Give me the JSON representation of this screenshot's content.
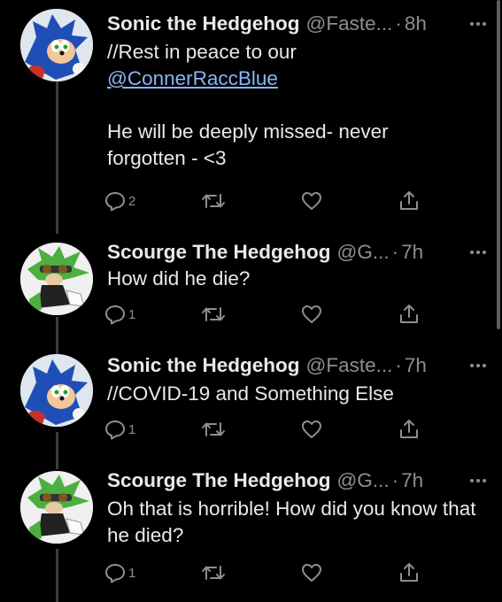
{
  "tweets": [
    {
      "display_name": "Sonic the Hedgehog",
      "handle": "@Faste...",
      "separator": "·",
      "time": "8h",
      "body_prefix": "//Rest in peace to our",
      "mention": "@ConnerRaccBlue",
      "body_suffix": "He will be deeply missed- never forgotten - <3",
      "reply_count": "2",
      "avatar": "sonic-avatar"
    },
    {
      "display_name": "Scourge The Hedgehog",
      "handle": "@G...",
      "separator": "·",
      "time": "7h",
      "body": "How did he die?",
      "reply_count": "1",
      "avatar": "scourge-avatar"
    },
    {
      "display_name": "Sonic the Hedgehog",
      "handle": "@Faste...",
      "separator": "·",
      "time": "7h",
      "body": "//COVID-19 and Something Else",
      "reply_count": "1",
      "avatar": "sonic-avatar"
    },
    {
      "display_name": "Scourge The Hedgehog",
      "handle": "@G...",
      "separator": "·",
      "time": "7h",
      "body": "Oh that is horrible! How did you know that he died?",
      "reply_count": "1",
      "avatar": "scourge-avatar"
    }
  ],
  "icons": {
    "reply": "reply-icon",
    "retweet": "retweet-icon",
    "like": "heart-icon",
    "share": "share-icon",
    "more": "more-icon"
  },
  "colors": {
    "background": "#000000",
    "text": "#e7e9ea",
    "muted": "#8b8f93",
    "mention": "#8ab4f8",
    "thread_line": "#3a3d41"
  }
}
